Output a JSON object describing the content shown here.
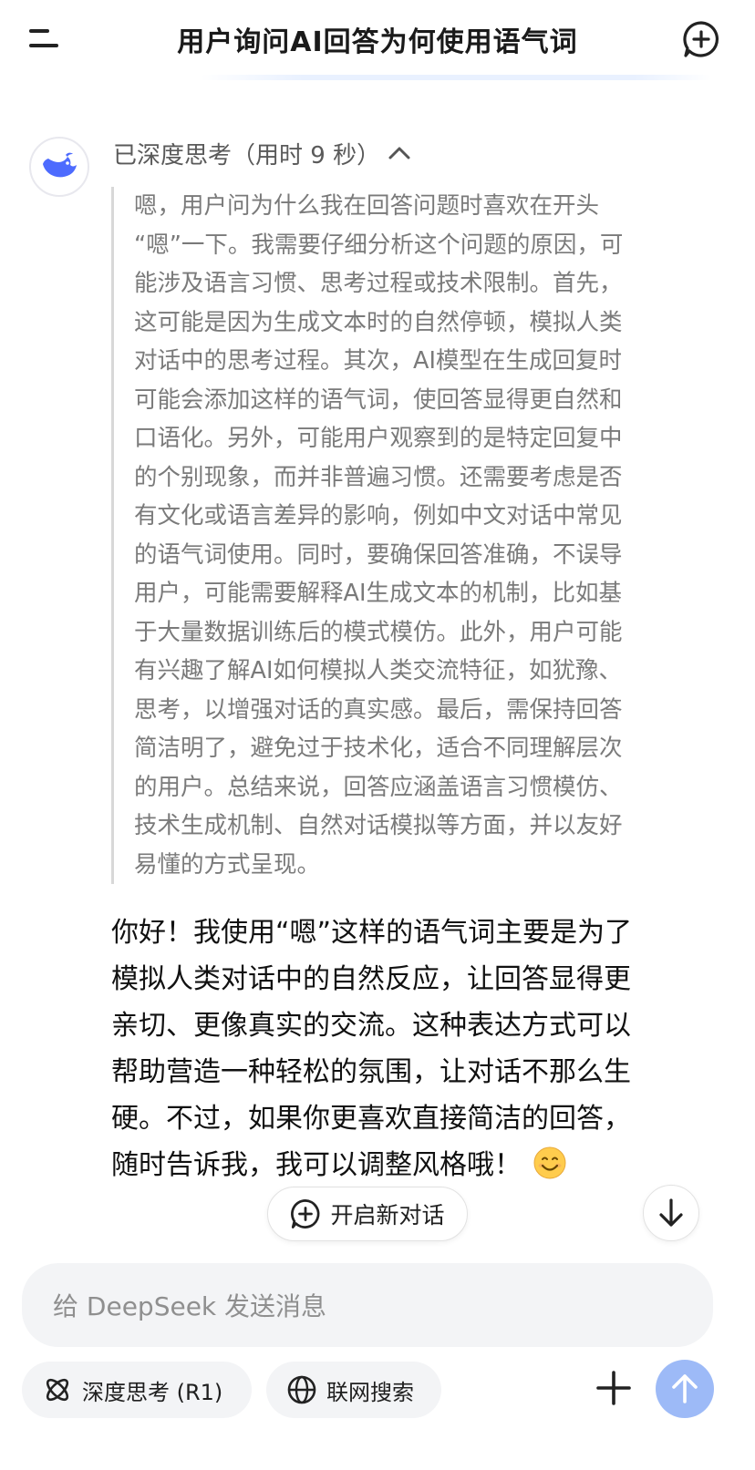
{
  "header": {
    "title": "用户询问AI回答为何使用语气词"
  },
  "thinking": {
    "label": "已深度思考（用时 9 秒）",
    "lines": [
      "嗯，用户问为什么我在回答问题时喜欢在开头",
      "“嗯”一下。我需要仔细分析这个问题的原因，可",
      "能涉及语言习惯、思考过程或技术限制。首先，",
      "这可能是因为生成文本时的自然停顿，模拟人类",
      "对话中的思考过程。其次，AI模型在生成回复时",
      "可能会添加这样的语气词，使回答显得更自然和",
      "口语化。另外，可能用户观察到的是特定回复中",
      "的个别现象，而并非普遍习惯。还需要考虑是否",
      "有文化或语言差异的影响，例如中文对话中常见",
      "的语气词使用。同时，要确保回答准确，不误导",
      "用户，可能需要解释AI生成文本的机制，比如基",
      "于大量数据训练后的模式模仿。此外，用户可能",
      "有兴趣了解AI如何模拟人类交流特征，如犹豫、",
      "思考，以增强对话的真实感。最后，需保持回答",
      "简洁明了，避免过于技术化，适合不同理解层次",
      "的用户。总结来说，回答应涵盖语言习惯模仿、",
      "技术生成机制、自然对话模拟等方面，并以友好",
      "易懂的方式呈现。"
    ]
  },
  "answer": {
    "lines": [
      "你好！我使用“嗯”这样的语气词主要是为了",
      "模拟人类对话中的自然反应，让回答显得更",
      "亲切、更像真实的交流。这种表达方式可以",
      "帮助营造一种轻松的氛围，让对话不那么生",
      "硬。不过，如果你更喜欢直接简洁的回答，",
      "随时告诉我，我可以调整风格哦！"
    ]
  },
  "buttons": {
    "new_dialog": "开启新对话",
    "deep_think": "深度思考 (R1)",
    "web_search": "联网搜索"
  },
  "input": {
    "placeholder": "给 DeepSeek 发送消息"
  },
  "colors": {
    "brand_blue": "#4D6BFE",
    "send_disabled": "#9DBAF7"
  }
}
